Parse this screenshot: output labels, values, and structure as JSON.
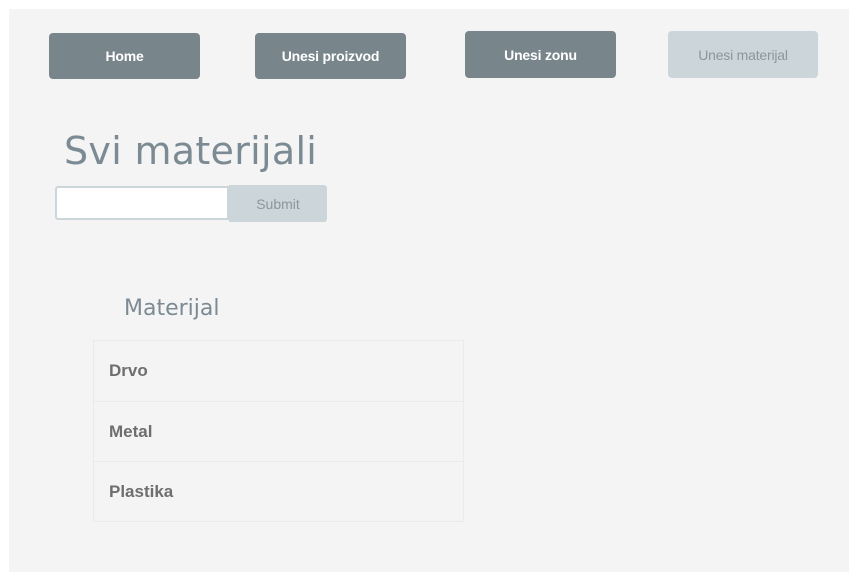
{
  "nav": {
    "home_label": "Home",
    "add_product_label": "Unesi proizvod",
    "add_zone_label": "Unesi zonu",
    "add_material_label": "Unesi materijal"
  },
  "main": {
    "title": "Svi materijali",
    "search": {
      "value": "",
      "placeholder": "",
      "submit_label": "Submit"
    },
    "table": {
      "header": "Materijal",
      "rows": [
        "Drvo",
        "Metal",
        "Plastika"
      ]
    }
  },
  "colors": {
    "nav_button_dark": "#78868c",
    "nav_button_light": "#ccd5da",
    "page_background": "#f4f4f4",
    "title_text": "#7b8a93"
  }
}
